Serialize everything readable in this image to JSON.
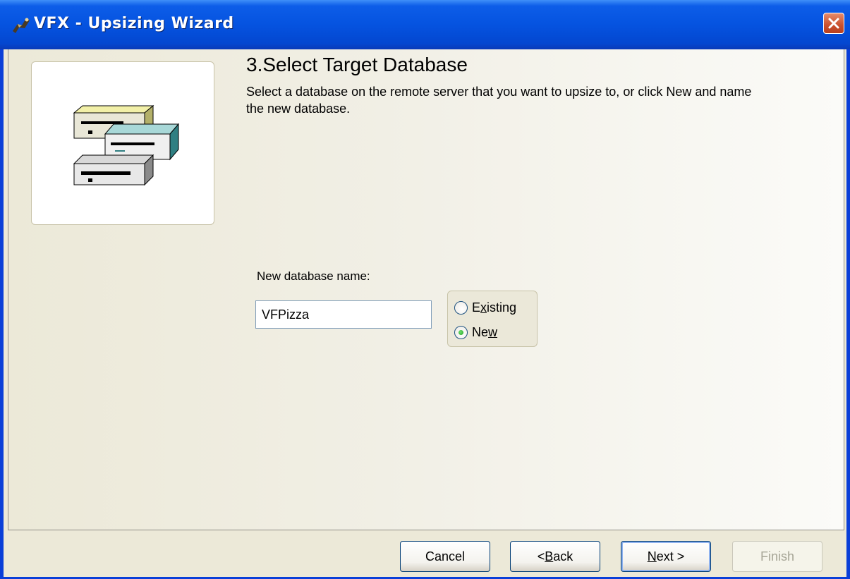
{
  "window": {
    "title": "VFX - Upsizing Wizard",
    "title_bar_color": "#0553e0",
    "close_button_color": "#c9502d"
  },
  "step": {
    "heading": "3.Select Target Database",
    "description": "Select a database on the remote server that you want to upsize to, or click New and name the new database."
  },
  "illustration": {
    "icon": "database-servers-icon"
  },
  "database": {
    "label": "New database name:",
    "value": "VFPizza"
  },
  "mode": {
    "options": [
      {
        "label_pre": "E",
        "label_key": "x",
        "label_post": "isting",
        "checked": false
      },
      {
        "label_pre": "Ne",
        "label_key": "w",
        "label_post": "",
        "checked": true
      }
    ]
  },
  "buttons": {
    "cancel": {
      "label": "Cancel"
    },
    "back": {
      "pre": "< ",
      "key": "B",
      "post": "ack"
    },
    "next": {
      "pre": "",
      "key": "N",
      "post": "ext >"
    },
    "finish": {
      "label": "Finish",
      "enabled": false
    }
  }
}
